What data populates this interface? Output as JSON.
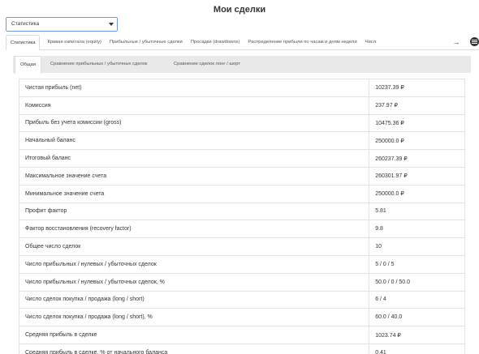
{
  "page": {
    "title": "Мои сделки"
  },
  "selector": {
    "value": "Статистика"
  },
  "tabs": [
    {
      "label": "Статистика",
      "active": true
    },
    {
      "label": "Кривая капитала (equity)",
      "active": false
    },
    {
      "label": "Прибыльные / убыточные сделки",
      "active": false
    },
    {
      "label": "Просадки (drawdowns)",
      "active": false
    },
    {
      "label": "Распределение прибыли по часам и дням недели",
      "active": false
    },
    {
      "label": "Числ",
      "active": false
    }
  ],
  "tab_controls": {
    "next_icon": "→",
    "menu_icon": "menu-icon"
  },
  "subtabs": [
    {
      "label": "Общая",
      "active": true
    },
    {
      "label": "Сравнение прибыльных / убыточных сделок",
      "active": false
    },
    {
      "label": "Сравнение сделок лонг / шорт",
      "active": false
    }
  ],
  "stats": [
    {
      "label": "Чистая прибыль (net)",
      "value": "10237.39 ₽"
    },
    {
      "label": "Комиссия",
      "value": "237.97 ₽"
    },
    {
      "label": "Прибыль без учета комиссии (gross)",
      "value": "10475.36 ₽"
    },
    {
      "label": "Начальный баланс",
      "value": "250000.0 ₽"
    },
    {
      "label": "Итоговый баланс",
      "value": "260237.39 ₽"
    },
    {
      "label": "Максимальное значение счета",
      "value": "260301.97 ₽"
    },
    {
      "label": "Минимальное значение счета",
      "value": "250000.0 ₽"
    },
    {
      "label": "Профит фактор",
      "value": "5.81"
    },
    {
      "label": "Фактор восстановления (recovery factor)",
      "value": "9.8"
    },
    {
      "label": "Общее число сделок",
      "value": "10"
    },
    {
      "label": "Число прибыльных / нулевых / убыточных сделок",
      "value": "5 / 0 / 5"
    },
    {
      "label": "Число прибыльных / нулевых / убыточных сделок, %",
      "value": "50.0 / 0 / 50.0"
    },
    {
      "label": "Число сделок покупка / продажа (long / short)",
      "value": "6 / 4"
    },
    {
      "label": "Число сделок покупка / продажа (long / short), %",
      "value": "60.0 / 40.0"
    },
    {
      "label": "Средняя прибыль в сделке",
      "value": "1023.74 ₽"
    },
    {
      "label": "Средняя прибыль в сделке, % от начального баланса",
      "value": "0.41"
    }
  ]
}
